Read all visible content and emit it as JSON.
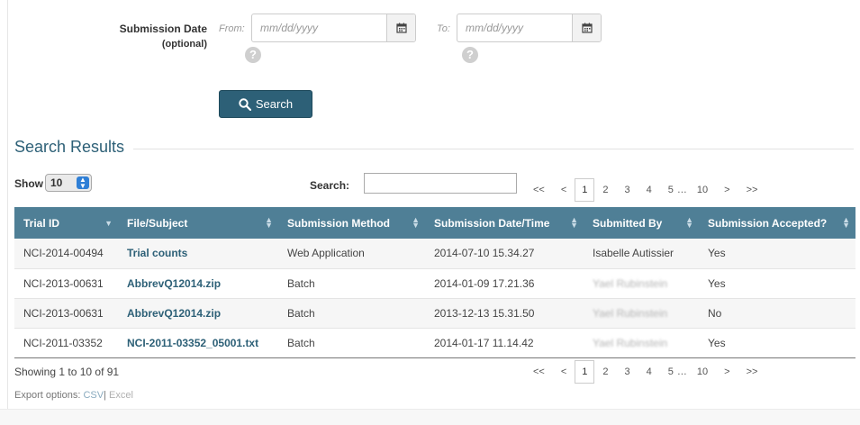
{
  "filter": {
    "label": "Submission Date",
    "optional": "(optional)",
    "from_label": "From:",
    "to_label": "To:",
    "from_placeholder": "mm/dd/yyyy",
    "to_placeholder": "mm/dd/yyyy",
    "help_glyph": "?",
    "search_button": "Search"
  },
  "results": {
    "title": "Search Results",
    "show_label": "Show",
    "show_value": "10",
    "search_label": "Search:",
    "pager": [
      "<<",
      "<",
      "1",
      "2",
      "3",
      "4",
      "5",
      "…",
      "10",
      ">",
      ">>"
    ],
    "current_page": "1",
    "columns": [
      "Trial ID",
      "File/Subject",
      "Submission Method",
      "Submission Date/Time",
      "Submitted By",
      "Submission Accepted?"
    ],
    "rows": [
      {
        "trial_id": "NCI-2014-00494",
        "file": "Trial counts",
        "method": "Web Application",
        "datetime": "2014-07-10 15.34.27",
        "by": "Isabelle Autissier",
        "accepted": "Yes"
      },
      {
        "trial_id": "NCI-2013-00631",
        "file": "AbbrevQ12014.zip",
        "method": "Batch",
        "datetime": "2014-01-09 17.21.36",
        "by": "Yael Rubinstein",
        "accepted": "Yes"
      },
      {
        "trial_id": "NCI-2013-00631",
        "file": "AbbrevQ12014.zip",
        "method": "Batch",
        "datetime": "2013-12-13 15.31.50",
        "by": "Yael Rubinstein",
        "accepted": "No"
      },
      {
        "trial_id": "NCI-2011-03352",
        "file": "NCI-2011-03352_05001.txt",
        "method": "Batch",
        "datetime": "2014-01-17 11.14.42",
        "by": "Yael Rubinstein",
        "accepted": "Yes"
      }
    ],
    "showing": "Showing 1 to 10 of 91",
    "export_label": "Export options:",
    "export_csv": "CSV",
    "export_sep": "|",
    "export_excel": "Excel"
  },
  "colors": {
    "header_bg": "#4f7f96",
    "accent": "#2d6077",
    "button_bg": "#2d6077"
  }
}
